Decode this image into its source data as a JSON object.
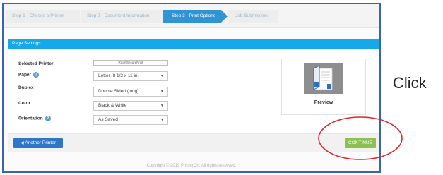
{
  "steps": [
    {
      "label": "Step 1 - Choose a Printer",
      "active": false
    },
    {
      "label": "Step 2 - Document Information",
      "active": false
    },
    {
      "label": "Step 3 - Print Options",
      "active": true
    },
    {
      "label": "Job Submission",
      "active": false
    }
  ],
  "section": {
    "title": "Page Settings"
  },
  "form": {
    "printer_label": "Selected Printer:",
    "printer_value": "RicohSecurePrint",
    "paper_label": "Paper",
    "paper_value": "Letter (8 1/2 x 11 in)",
    "duplex_label": "Duplex",
    "duplex_value": "Double Sided (long)",
    "color_label": "Color",
    "color_value": "Black & White",
    "orientation_label": "Orientation",
    "orientation_value": "As Saved"
  },
  "preview": {
    "label": "Preview"
  },
  "actions": {
    "another_printer_label": "Another Printer",
    "continue_label": "CONTINUE"
  },
  "footer": {
    "copyright": "Copyright © 2019 PrinterOn. All rights reserved."
  },
  "annotation": {
    "text": "Click",
    "ring_color": "#e0242b"
  },
  "colors": {
    "accent": "#15a9ea",
    "step_active": "#2f93d4",
    "continue": "#8cc152",
    "another": "#2e77c7",
    "frame": "#3a64b0"
  },
  "icons": [
    "help-icon",
    "caret-down-icon",
    "printer-glyph-icon",
    "document-preview-icon"
  ]
}
